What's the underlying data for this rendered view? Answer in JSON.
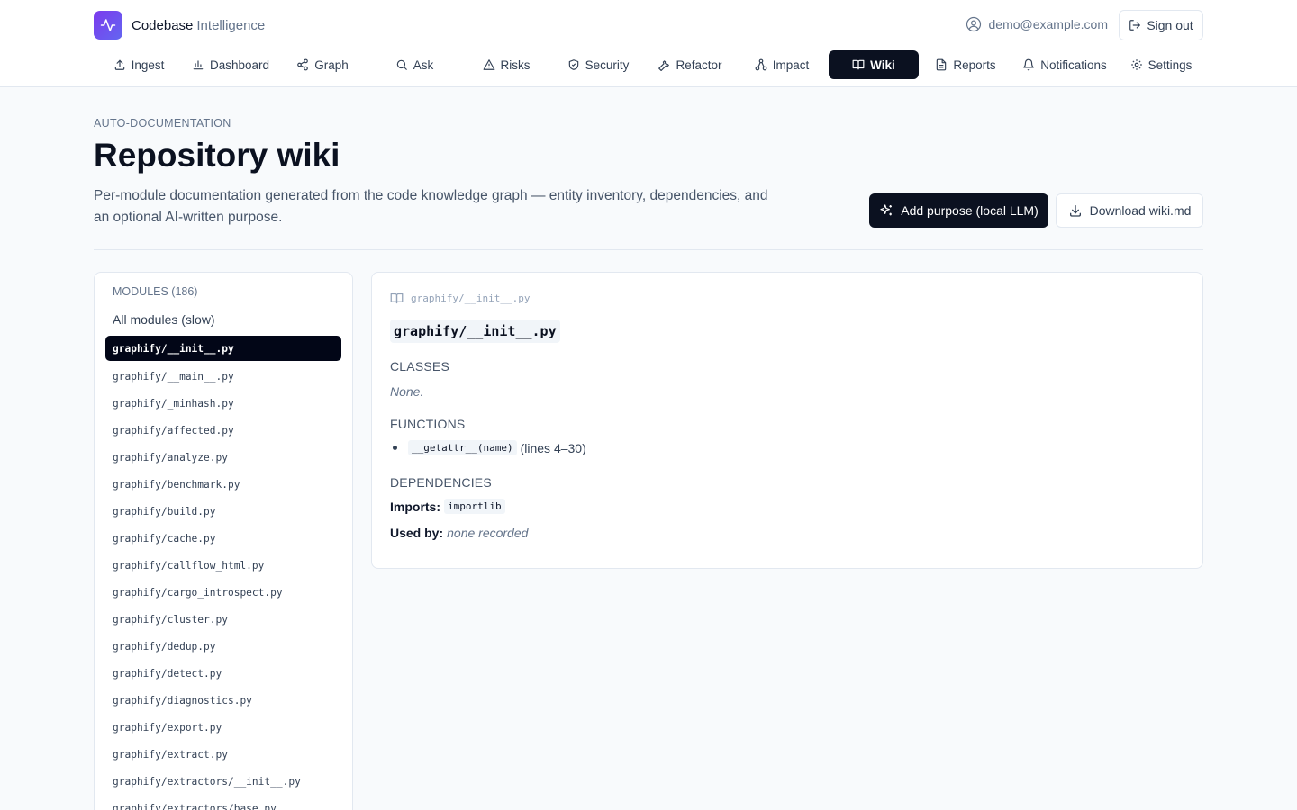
{
  "app": {
    "brand_name": "Codebase",
    "brand_sub": "Intelligence"
  },
  "header": {
    "user_email": "demo@example.com",
    "signout_label": "Sign out"
  },
  "nav": {
    "items": [
      {
        "label": "Ingest",
        "icon": "upload-icon"
      },
      {
        "label": "Dashboard",
        "icon": "bar-chart-icon"
      },
      {
        "label": "Graph",
        "icon": "share-icon"
      },
      {
        "label": "Ask",
        "icon": "search-icon"
      },
      {
        "label": "Risks",
        "icon": "warning-icon"
      },
      {
        "label": "Security",
        "icon": "shield-icon"
      },
      {
        "label": "Refactor",
        "icon": "wrench-icon"
      },
      {
        "label": "Impact",
        "icon": "network-icon"
      },
      {
        "label": "Wiki",
        "icon": "book-icon",
        "active": true
      },
      {
        "label": "Reports",
        "icon": "file-icon"
      },
      {
        "label": "Notifications",
        "icon": "bell-icon"
      },
      {
        "label": "Settings",
        "icon": "gear-icon"
      }
    ]
  },
  "page": {
    "eyebrow": "AUTO-DOCUMENTATION",
    "title": "Repository wiki",
    "description": "Per-module documentation generated from the code knowledge graph — entity inventory, dependencies, and an optional AI-written purpose.",
    "primary_button": "Add purpose (local LLM)",
    "secondary_button": "Download wiki.md"
  },
  "sidebar": {
    "heading": "MODULES (186)",
    "all_modules": "All modules (slow)",
    "selected_index": 0,
    "modules": [
      "graphify/__init__.py",
      "graphify/__main__.py",
      "graphify/_minhash.py",
      "graphify/affected.py",
      "graphify/analyze.py",
      "graphify/benchmark.py",
      "graphify/build.py",
      "graphify/cache.py",
      "graphify/callflow_html.py",
      "graphify/cargo_introspect.py",
      "graphify/cluster.py",
      "graphify/dedup.py",
      "graphify/detect.py",
      "graphify/diagnostics.py",
      "graphify/export.py",
      "graphify/extract.py",
      "graphify/extractors/__init__.py",
      "graphify/extractors/base.py"
    ]
  },
  "detail": {
    "breadcrumb": "graphify/__init__.py",
    "module_title": "graphify/__init__.py",
    "classes_heading": "CLASSES",
    "classes_none": "None.",
    "functions_heading": "FUNCTIONS",
    "functions": [
      {
        "signature": "__getattr__(name)",
        "lines": "(lines 4–30)"
      }
    ],
    "dependencies_heading": "DEPENDENCIES",
    "imports_label": "Imports:",
    "imports": [
      "importlib"
    ],
    "used_by_label": "Used by:",
    "used_by_value": "none recorded"
  }
}
